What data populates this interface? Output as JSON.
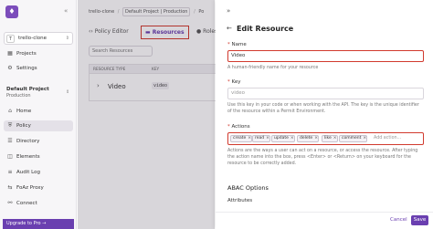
{
  "sidebar": {
    "workspace": {
      "avatar": "T",
      "name": "trello-clone"
    },
    "top_items": [
      {
        "label": "Projects",
        "icon": "projects-icon"
      },
      {
        "label": "Settings",
        "icon": "settings-icon"
      }
    ],
    "project": {
      "name": "Default Project",
      "env": "Production"
    },
    "items": [
      {
        "label": "Home",
        "icon": "home-icon",
        "active": false
      },
      {
        "label": "Policy",
        "icon": "policy-icon",
        "active": true
      },
      {
        "label": "Directory",
        "icon": "directory-icon",
        "active": false
      },
      {
        "label": "Elements",
        "icon": "elements-icon",
        "active": false
      },
      {
        "label": "Audit Log",
        "icon": "audit-log-icon",
        "active": false
      },
      {
        "label": "FoAz Proxy",
        "icon": "proxy-icon",
        "active": false
      },
      {
        "label": "Connect",
        "icon": "connect-icon",
        "active": false
      }
    ],
    "upgrade_label": "Upgrade to Pro →"
  },
  "main": {
    "breadcrumb": [
      "trello-clone",
      "Default Project | Production",
      "Po"
    ],
    "tabs": [
      {
        "label": "Policy Editor"
      },
      {
        "label": "Resources"
      },
      {
        "label": "Roles"
      }
    ],
    "search_placeholder": "Search Resources",
    "table": {
      "headers": [
        "RESOURCE TYPE",
        "KEY"
      ],
      "rows": [
        {
          "name": "Video",
          "key": "video"
        }
      ]
    }
  },
  "panel": {
    "title": "Edit Resource",
    "name": {
      "label": "Name",
      "value": "Video",
      "help": "A human-friendly name for your resource"
    },
    "key": {
      "label": "Key",
      "value": "video",
      "help": "Use this key in your code or when working with the API. The key is the unique identifier of the resource within a Permit Environment."
    },
    "actions": {
      "label": "Actions",
      "tags": [
        "create",
        "read",
        "update",
        "delete",
        "like",
        "comment"
      ],
      "placeholder": "Add action...",
      "help": "Actions are the ways a user can act on a resource, or access the resource. After typing the action name into the box, press <Enter> or <Return> on your keyboard for the resource to be correctly added."
    },
    "abac_title": "ABAC Options",
    "attributes_label": "Attributes",
    "cancel_label": "Cancel",
    "save_label": "Save"
  },
  "colors": {
    "accent": "#6a3fb0",
    "error_outline": "#d13a2e"
  }
}
